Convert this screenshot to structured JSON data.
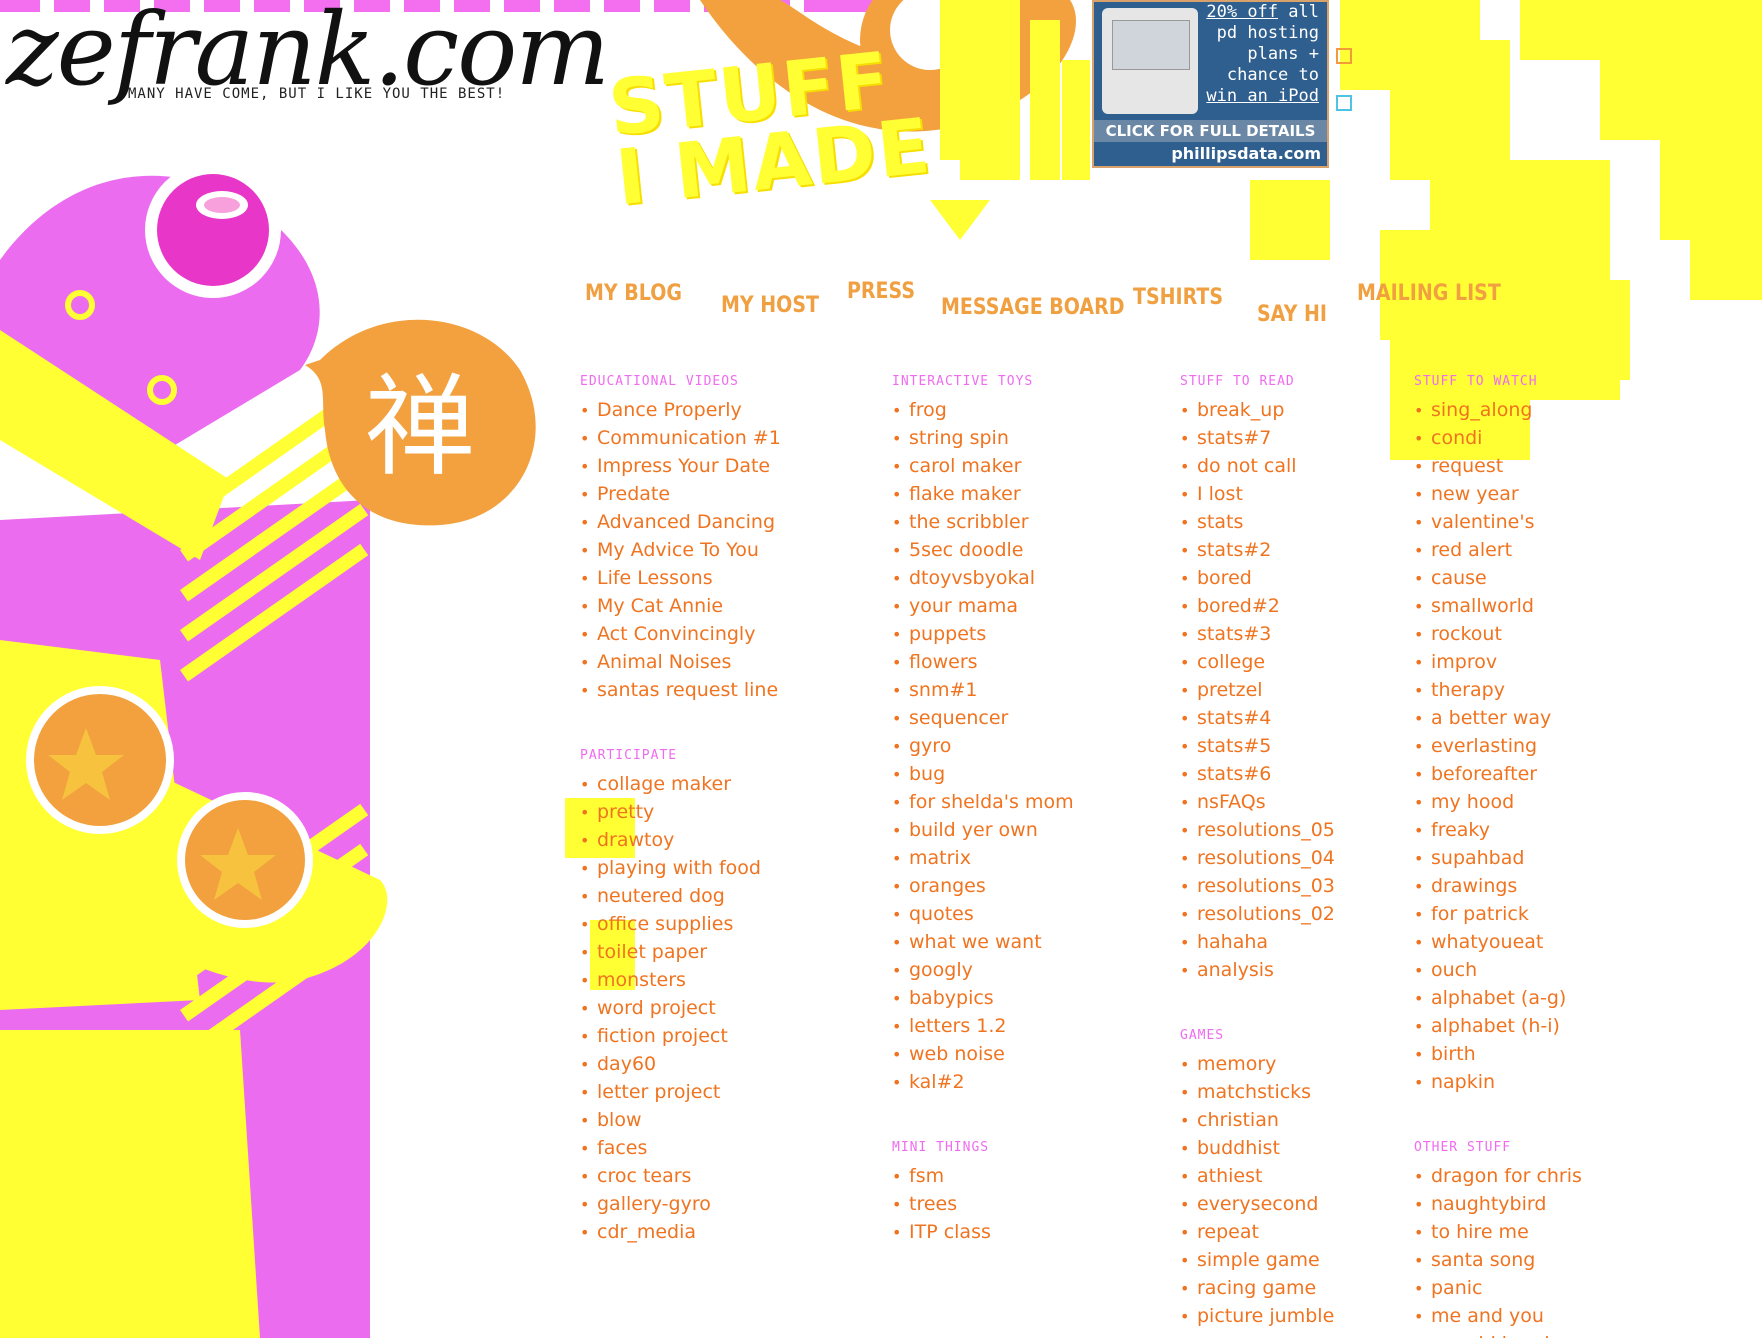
{
  "site": {
    "logo": "zefrank.com",
    "tagline": "MANY HAVE COME, BUT I LIKE YOU THE BEST!"
  },
  "header_art": {
    "title_lines": [
      "STUFF",
      "I MADE"
    ],
    "badge_glyph": "禅"
  },
  "ad": {
    "line1": "20% off",
    "line1b": "all",
    "line2": "pd hosting",
    "line3": "plans +",
    "line4": "chance to",
    "line5": "win an iPod",
    "cta": "CLICK FOR FULL DETAILS",
    "domain": "phillipsdata.com"
  },
  "nav": [
    "MY BLOG",
    "MY HOST",
    "PRESS",
    "MESSAGE BOARD",
    "TSHIRTS",
    "SAY HI",
    "MAILING LIST"
  ],
  "columns": [
    {
      "sections": [
        {
          "title": "EDUCATIONAL VIDEOS",
          "items": [
            "Dance Properly",
            "Communication #1",
            "Impress Your Date",
            "Predate",
            "Advanced Dancing",
            "My Advice To You",
            "Life Lessons",
            "My Cat Annie",
            "Act Convincingly",
            "Animal Noises",
            "santas request line"
          ]
        },
        {
          "title": "PARTICIPATE",
          "items": [
            "collage maker",
            "pretty",
            "drawtoy",
            "playing with food",
            "neutered dog",
            "office supplies",
            "toilet paper",
            "monsters",
            "word project",
            "fiction project",
            "day60",
            "letter project",
            "blow",
            "faces",
            "croc tears",
            "gallery-gyro",
            "cdr_media"
          ]
        }
      ]
    },
    {
      "sections": [
        {
          "title": "INTERACTIVE TOYS",
          "items": [
            "frog",
            "string spin",
            "carol maker",
            "flake maker",
            "the scribbler",
            "5sec doodle",
            "dtoyvsbyokal",
            "your mama",
            "puppets",
            "flowers",
            "snm#1",
            "sequencer",
            "gyro",
            "bug",
            "for shelda's mom",
            "build yer own",
            "matrix",
            "oranges",
            "quotes",
            "what we want",
            "googly",
            "babypics",
            "letters 1.2",
            "web noise",
            "kal#2"
          ]
        },
        {
          "title": "MINI THINGS",
          "items": [
            "fsm",
            "trees",
            "ITP class"
          ]
        }
      ]
    },
    {
      "sections": [
        {
          "title": "STUFF TO READ",
          "items": [
            "break_up",
            "stats#7",
            "do not call",
            "I lost",
            "stats",
            "stats#2",
            "bored",
            "bored#2",
            "stats#3",
            "college",
            "pretzel",
            "stats#4",
            "stats#5",
            "stats#6",
            "nsFAQs",
            "resolutions_05",
            "resolutions_04",
            "resolutions_03",
            "resolutions_02",
            "hahaha",
            "analysis"
          ]
        },
        {
          "title": "GAMES",
          "items": [
            "memory",
            "matchsticks",
            "christian",
            "buddhist",
            "athiest",
            "everysecond",
            "repeat",
            "simple game",
            "racing game",
            "picture jumble"
          ]
        }
      ]
    },
    {
      "sections": [
        {
          "title": "STUFF TO WATCH",
          "items": [
            "sing_along",
            "condi",
            "request",
            "new year",
            "valentine's",
            "red alert",
            "cause",
            "smallworld",
            "rockout",
            "improv",
            "therapy",
            "a better way",
            "everlasting",
            "beforeafter",
            "my hood",
            "freaky",
            "supahbad",
            "drawings",
            "for patrick",
            "whatyoueat",
            "ouch",
            "alphabet (a-g)",
            "alphabet (h-i)",
            "birth",
            "napkin"
          ]
        },
        {
          "title": "OTHER STUFF",
          "items": [
            "dragon for chris",
            "naughtybird",
            "to hire me",
            "santa song",
            "panic",
            "me and you",
            "my old band"
          ]
        }
      ]
    }
  ],
  "colors": {
    "link": "#f07420",
    "section": "#f06bf0",
    "nav": "#f0a040",
    "yellow": "#ffff33",
    "magenta": "#ec6cf0",
    "orange": "#f39a3a"
  }
}
